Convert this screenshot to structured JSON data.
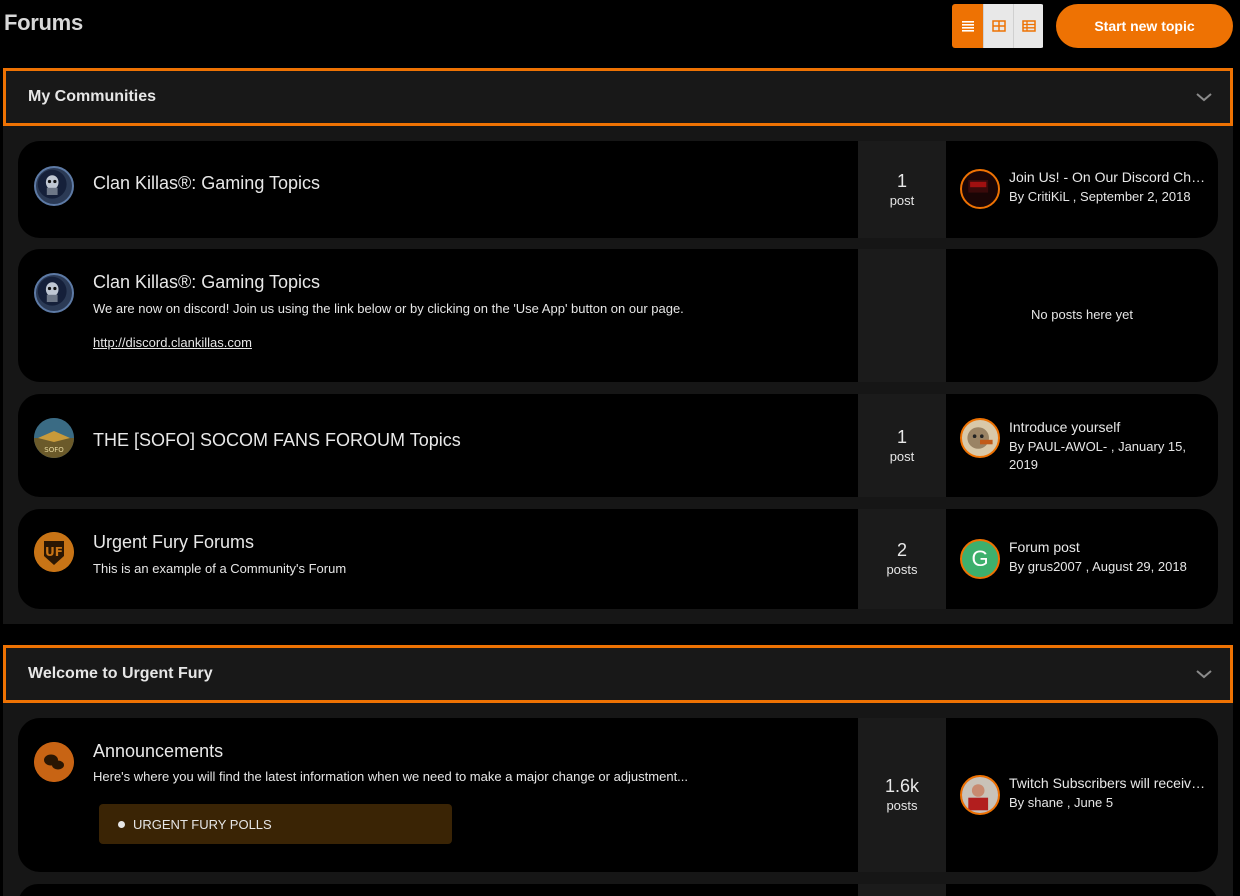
{
  "page": {
    "title": "Forums"
  },
  "toolbar": {
    "start_topic_label": "Start new topic",
    "views": [
      {
        "icon": "list-view-icon",
        "active": true
      },
      {
        "icon": "grid-view-icon",
        "active": false
      },
      {
        "icon": "table-view-icon",
        "active": false
      }
    ]
  },
  "colors": {
    "accent": "#ee7203",
    "background": "#000000",
    "panel": "#161616",
    "stats_bg": "#1b1b1b",
    "subforum_bg": "#3a2405"
  },
  "categories": [
    {
      "title": "My Communities",
      "forums": [
        {
          "icon": "clan-killas-icon",
          "title": "Clan Killas®: Gaming Topics",
          "count": "1",
          "count_label": "post",
          "last_title": "Join Us! - On Our Discord Channel",
          "last_meta": "By CritiKiL , September 2, 2018",
          "last_avatar": "user-avatar-critikil"
        },
        {
          "icon": "clan-killas-icon",
          "title": "Clan Killas®: Gaming Topics",
          "description": "We are now on discord! Join us using the link below or by clicking on the 'Use App' button on our page.",
          "link": "http://discord.clankillas.com",
          "no_posts": "No posts here yet"
        },
        {
          "icon": "sofo-socom-icon",
          "title": "THE [SOFO] SOCOM FANS FOROUM Topics",
          "count": "1",
          "count_label": "post",
          "last_title": "Introduce yourself",
          "last_meta": "By PAUL-AWOL- , January 15, 2019",
          "last_avatar": "user-avatar-paul-awol"
        },
        {
          "icon": "urgent-fury-logo-icon",
          "title": "Urgent Fury Forums",
          "description": "This is an example of a Community's Forum",
          "count": "2",
          "count_label": "posts",
          "last_title": "Forum post",
          "last_meta": "By grus2007 , August 29, 2018",
          "last_avatar": "user-avatar-grus2007",
          "last_avatar_letter": "G"
        }
      ]
    },
    {
      "title": "Welcome to Urgent Fury",
      "forums": [
        {
          "icon": "chat-bubbles-icon",
          "title": "Announcements",
          "description": "Here's where you will find the latest information when we need to make a major change or adjustment...",
          "subforum": "URGENT FURY POLLS",
          "count": "1.6k",
          "count_label": "posts",
          "last_title": "Twitch Subscribers will receive perks",
          "last_meta": "By shane , June 5",
          "last_avatar": "user-avatar-shane"
        }
      ]
    }
  ]
}
